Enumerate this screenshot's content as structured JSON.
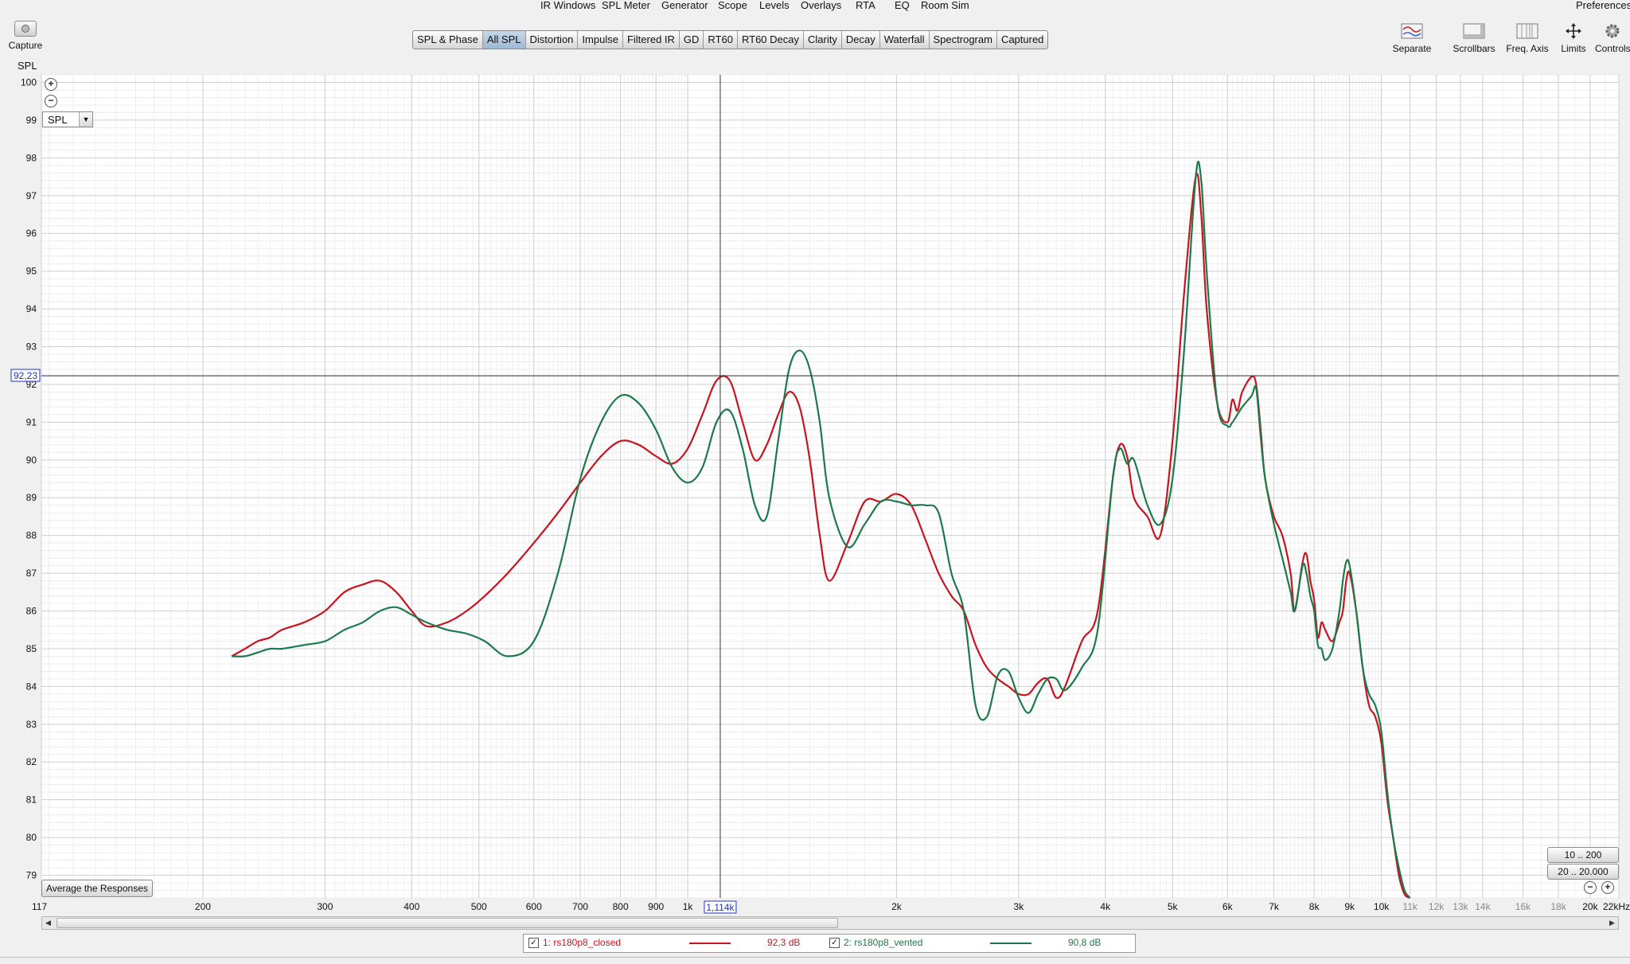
{
  "menu": [
    "IR Windows",
    "SPL Meter",
    "Generator",
    "Scope",
    "Levels",
    "Overlays",
    "RTA",
    "EQ",
    "Room Sim"
  ],
  "preferences_label": "Preferences",
  "capture_label": "Capture",
  "tabs": [
    {
      "label": "SPL & Phase"
    },
    {
      "label": "All SPL",
      "active": true
    },
    {
      "label": "Distortion"
    },
    {
      "label": "Impulse"
    },
    {
      "label": "Filtered IR"
    },
    {
      "label": "GD"
    },
    {
      "label": "RT60"
    },
    {
      "label": "RT60 Decay"
    },
    {
      "label": "Clarity"
    },
    {
      "label": "Decay"
    },
    {
      "label": "Waterfall"
    },
    {
      "label": "Spectrogram"
    },
    {
      "label": "Captured"
    }
  ],
  "toolbar_right": [
    {
      "label": "Separate",
      "icon": "separate-icon"
    },
    {
      "label": "Scrollbars",
      "icon": "scrollbars-icon"
    },
    {
      "label": "Freq. Axis",
      "icon": "freq-axis-icon"
    },
    {
      "label": "Limits",
      "icon": "limits-icon"
    },
    {
      "label": "Controls",
      "icon": "gear-icon"
    }
  ],
  "y_unit": "SPL",
  "spl_select": "SPL",
  "avg_button": "Average the Responses",
  "range_buttons": [
    "10 .. 200",
    "20 .. 20.000"
  ],
  "cursor": {
    "x_readout": "1,114k",
    "y_readout": "92,23"
  },
  "legend": [
    {
      "label": "1: rs180p8_closed",
      "value": "92,3 dB",
      "color": "#c8141e"
    },
    {
      "label": "2: rs180p8_vented",
      "value": "90,8 dB",
      "color": "#1c7a4a"
    }
  ],
  "chart_data": {
    "type": "line",
    "title": "",
    "xlabel": "",
    "ylabel": "SPL",
    "x_scale": "log",
    "xlim": [
      117,
      22000
    ],
    "ylim": [
      78.4,
      100.2
    ],
    "grid": true,
    "y_ticks": [
      79,
      80,
      81,
      82,
      83,
      84,
      85,
      86,
      87,
      88,
      89,
      90,
      91,
      92,
      93,
      94,
      95,
      96,
      97,
      98,
      99,
      100
    ],
    "x_ticks": [
      {
        "v": 117,
        "label": "117"
      },
      {
        "v": 200,
        "label": "200"
      },
      {
        "v": 300,
        "label": "300"
      },
      {
        "v": 400,
        "label": "400"
      },
      {
        "v": 500,
        "label": "500"
      },
      {
        "v": 600,
        "label": "600"
      },
      {
        "v": 700,
        "label": "700"
      },
      {
        "v": 800,
        "label": "800"
      },
      {
        "v": 900,
        "label": "900"
      },
      {
        "v": 1000,
        "label": "1k"
      },
      {
        "v": 2000,
        "label": "2k"
      },
      {
        "v": 3000,
        "label": "3k"
      },
      {
        "v": 4000,
        "label": "4k"
      },
      {
        "v": 5000,
        "label": "5k"
      },
      {
        "v": 6000,
        "label": "6k"
      },
      {
        "v": 7000,
        "label": "7k"
      },
      {
        "v": 8000,
        "label": "8k"
      },
      {
        "v": 9000,
        "label": "9k"
      },
      {
        "v": 10000,
        "label": "10k"
      },
      {
        "v": 11000,
        "label": "11k"
      },
      {
        "v": 12000,
        "label": "12k"
      },
      {
        "v": 13000,
        "label": "13k"
      },
      {
        "v": 14000,
        "label": "14k"
      },
      {
        "v": 16000,
        "label": "16k"
      },
      {
        "v": 18000,
        "label": "18k"
      },
      {
        "v": 20000,
        "label": "20k"
      },
      {
        "v": 22000,
        "label": "22kHz"
      }
    ],
    "cursor_x": 1114,
    "cursor_y": 92.23,
    "series": [
      {
        "name": "1: rs180p8_closed",
        "color": "#c8141e",
        "x": [
          220,
          230,
          240,
          250,
          260,
          280,
          300,
          320,
          340,
          360,
          380,
          400,
          420,
          450,
          480,
          510,
          550,
          600,
          650,
          700,
          750,
          800,
          850,
          900,
          950,
          1000,
          1050,
          1100,
          1150,
          1200,
          1250,
          1300,
          1350,
          1400,
          1450,
          1500,
          1550,
          1600,
          1700,
          1800,
          1900,
          2000,
          2100,
          2200,
          2300,
          2400,
          2500,
          2600,
          2700,
          2800,
          2900,
          3000,
          3100,
          3200,
          3300,
          3400,
          3500,
          3700,
          3900,
          4100,
          4200,
          4300,
          4400,
          4600,
          4800,
          5000,
          5200,
          5400,
          5500,
          5600,
          5800,
          6000,
          6100,
          6200,
          6300,
          6500,
          6600,
          6700,
          6800,
          7000,
          7200,
          7400,
          7500,
          7700,
          7800,
          7900,
          8000,
          8100,
          8200,
          8300,
          8500,
          8700,
          8800,
          8900,
          9000,
          9200,
          9400,
          9600,
          9800,
          10000,
          10200,
          10400,
          10600,
          10800,
          11000
        ],
        "y": [
          84.8,
          85.0,
          85.2,
          85.3,
          85.5,
          85.7,
          86.0,
          86.5,
          86.7,
          86.8,
          86.5,
          86.0,
          85.6,
          85.7,
          86.0,
          86.4,
          87.0,
          87.8,
          88.6,
          89.4,
          90.1,
          90.5,
          90.4,
          90.1,
          89.9,
          90.3,
          91.2,
          92.1,
          92.1,
          91.0,
          90.0,
          90.4,
          91.2,
          91.8,
          91.4,
          90.0,
          88.0,
          86.8,
          87.8,
          88.9,
          88.9,
          89.1,
          88.8,
          87.9,
          87.0,
          86.4,
          86.0,
          85.1,
          84.5,
          84.2,
          84.0,
          83.8,
          83.8,
          84.1,
          84.2,
          83.7,
          84.0,
          85.2,
          86.0,
          89.5,
          90.4,
          90.1,
          89.0,
          88.5,
          88.0,
          90.5,
          94.5,
          97.5,
          96.5,
          94.0,
          91.5,
          91.0,
          91.6,
          91.3,
          91.8,
          92.2,
          92.0,
          90.8,
          89.5,
          88.5,
          88.0,
          87.0,
          86.0,
          87.3,
          87.5,
          86.8,
          86.3,
          85.3,
          85.7,
          85.5,
          85.2,
          85.7,
          86.0,
          86.8,
          87.0,
          86.0,
          84.5,
          83.5,
          83.2,
          82.5,
          81.0,
          80.0,
          79.0,
          78.5,
          78.0
        ]
      },
      {
        "name": "2: rs180p8_vented",
        "color": "#1c7a4a",
        "x": [
          220,
          230,
          240,
          250,
          260,
          280,
          300,
          320,
          340,
          360,
          380,
          400,
          420,
          450,
          480,
          510,
          550,
          600,
          650,
          700,
          750,
          800,
          850,
          900,
          950,
          1000,
          1050,
          1100,
          1150,
          1200,
          1250,
          1300,
          1350,
          1400,
          1450,
          1500,
          1550,
          1600,
          1700,
          1800,
          1900,
          2000,
          2100,
          2200,
          2300,
          2400,
          2500,
          2600,
          2700,
          2800,
          2900,
          3000,
          3100,
          3200,
          3300,
          3400,
          3500,
          3700,
          3900,
          4100,
          4200,
          4300,
          4400,
          4600,
          4800,
          5000,
          5200,
          5400,
          5500,
          5600,
          5800,
          6000,
          6100,
          6200,
          6300,
          6500,
          6600,
          6700,
          6800,
          7000,
          7200,
          7400,
          7500,
          7700,
          7800,
          7900,
          8000,
          8100,
          8200,
          8300,
          8500,
          8700,
          8800,
          8900,
          9000,
          9200,
          9400,
          9600,
          9800,
          10000,
          10200,
          10400,
          10600,
          10800,
          11000
        ],
        "y": [
          84.8,
          84.8,
          84.9,
          85.0,
          85.0,
          85.1,
          85.2,
          85.5,
          85.7,
          86.0,
          86.1,
          85.9,
          85.7,
          85.5,
          85.4,
          85.2,
          84.8,
          85.2,
          87.0,
          89.5,
          91.0,
          91.7,
          91.5,
          90.8,
          89.8,
          89.4,
          89.8,
          91.0,
          91.3,
          90.3,
          88.8,
          88.5,
          90.5,
          92.4,
          92.9,
          92.4,
          91.0,
          89.0,
          87.7,
          88.3,
          88.9,
          88.9,
          88.8,
          88.8,
          88.6,
          87.0,
          86.0,
          83.5,
          83.2,
          84.3,
          84.4,
          83.7,
          83.3,
          83.8,
          84.2,
          84.2,
          83.9,
          84.5,
          85.5,
          89.5,
          90.3,
          89.9,
          90.0,
          88.8,
          88.3,
          89.5,
          93.0,
          97.5,
          97.4,
          95.0,
          91.5,
          90.9,
          91.0,
          91.2,
          91.4,
          91.7,
          91.9,
          90.6,
          89.5,
          88.3,
          87.4,
          86.5,
          86.0,
          87.2,
          87.0,
          86.4,
          86.0,
          85.1,
          85.0,
          84.7,
          85.0,
          86.0,
          86.8,
          87.3,
          87.2,
          86.0,
          84.5,
          83.8,
          83.5,
          82.8,
          81.2,
          80.0,
          79.2,
          78.6,
          78.0
        ]
      }
    ]
  }
}
